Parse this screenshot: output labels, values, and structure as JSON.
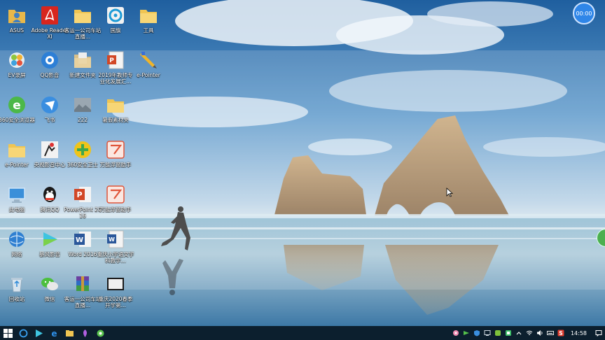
{
  "desktop": {
    "icons": [
      {
        "label": "ASUS",
        "icon": "asus-user-folder-icon"
      },
      {
        "label": "Adobe Reader XI",
        "icon": "adobe-reader-icon"
      },
      {
        "label": "客运一公司车站直播...",
        "icon": "folder-icon"
      },
      {
        "label": "国旗",
        "icon": "ppt-player-icon"
      },
      {
        "label": "工具",
        "icon": "folder-icon"
      },
      {
        "label": "EV录屏",
        "icon": "ev-recorder-icon"
      },
      {
        "label": "QQ影音",
        "icon": "qq-player-icon"
      },
      {
        "label": "新建文件夹",
        "icon": "folder-icon"
      },
      {
        "label": "2019年教师专业化发展汇...",
        "icon": "ppt-file-icon"
      },
      {
        "label": "e-Pointer",
        "icon": "pen-pointer-icon"
      },
      {
        "label": "360安全浏览器",
        "icon": "browser-360-icon"
      },
      {
        "label": "飞书",
        "icon": "feishu-icon"
      },
      {
        "label": "222",
        "icon": "image-file-icon"
      },
      {
        "label": "暑假素材夹",
        "icon": "folder-icon"
      },
      {
        "label": "e-Pointer",
        "icon": "folder-icon"
      },
      {
        "label": "央视影音中心",
        "icon": "cctv-center-icon"
      },
      {
        "label": "360安全卫士",
        "icon": "security-360-icon"
      },
      {
        "label": "万能浮窗助手",
        "icon": "wps-icon"
      },
      {
        "label": "此电脑",
        "icon": "computer-icon"
      },
      {
        "label": "腾讯QQ",
        "icon": "qq-icon"
      },
      {
        "label": "PowerPoint 2016",
        "icon": "powerpoint-icon"
      },
      {
        "label": "万能浮窗助手",
        "icon": "wps-icon"
      },
      {
        "label": "网络",
        "icon": "network-icon"
      },
      {
        "label": "暴风影音",
        "icon": "media-player-icon"
      },
      {
        "label": "Word 2016",
        "icon": "word-icon"
      },
      {
        "label": "重庆小学语文学科教学...",
        "icon": "word-file-icon"
      },
      {
        "label": "回收站",
        "icon": "recycle-bin-icon"
      },
      {
        "label": "微信",
        "icon": "wechat-icon"
      },
      {
        "label": "客运一公司车站直播...",
        "icon": "winrar-icon"
      },
      {
        "label": "重庆2020春季开学第...",
        "icon": "video-file-icon"
      }
    ]
  },
  "widgets": {
    "timer": "00:00"
  },
  "taskbar": {
    "start": "start-icon",
    "apps": [
      "search-icon",
      "media-player-icon",
      "edge-icon",
      "explorer-icon",
      "feather-icon",
      "qq-browser-icon"
    ],
    "tray": [
      "flower-icon",
      "green-arrow-icon",
      "shield-icon",
      "monitor-icon",
      "green-leaf-icon",
      "app-icon",
      "chevron-up-icon",
      "wifi-icon",
      "volume-icon",
      "keyboard-icon",
      "ime-icon"
    ],
    "clock": "14:58"
  },
  "colors": {
    "taskbar": "#0c1f2e",
    "sky_top": "#2d6fb0",
    "sea": "#7fb3cf",
    "timer": "#2f86e8"
  }
}
